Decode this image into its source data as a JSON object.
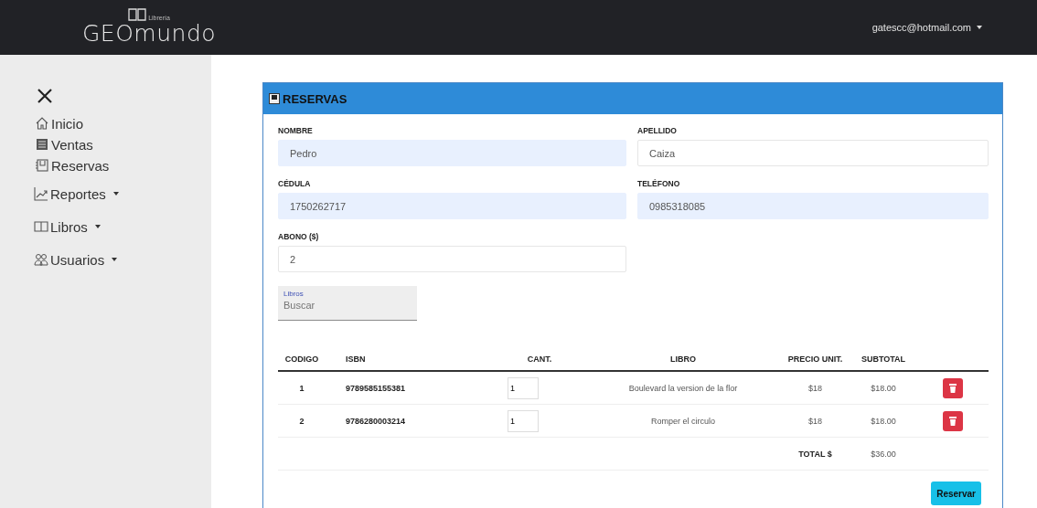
{
  "navbar": {
    "brand_small": "Librería",
    "brand_bold": "GEO",
    "brand_rest": "mundo",
    "user": "gatescc@hotmail.com"
  },
  "sidebar": {
    "items": [
      {
        "label": "Inicio",
        "kind": "link"
      },
      {
        "label": "Ventas",
        "kind": "link"
      },
      {
        "label": "Reservas",
        "kind": "link"
      },
      {
        "label": "Reportes",
        "kind": "dropdown"
      },
      {
        "label": "Libros",
        "kind": "dropdown"
      },
      {
        "label": "Usuarios",
        "kind": "dropdown"
      }
    ]
  },
  "card": {
    "title": "RESERVAS",
    "fields": [
      {
        "label": "NOMBRE",
        "value": "Pedro",
        "autofilled": true
      },
      {
        "label": "APELLIDO",
        "value": "Caiza",
        "autofilled": false
      },
      {
        "label": "CÉDULA",
        "value": "1750262717",
        "autofilled": true
      },
      {
        "label": "TELÉFONO",
        "value": "0985318085",
        "autofilled": true
      },
      {
        "label": "ABONO ($)",
        "value": "2",
        "autofilled": false
      }
    ],
    "search": {
      "label": "Libros",
      "placeholder": "Buscar"
    },
    "table": {
      "columns": [
        "CODIGO",
        "ISBN",
        "CANT.",
        "LIBRO",
        "PRECIO UNIT.",
        "SUBTOTAL"
      ],
      "rows": [
        {
          "codigo": "1",
          "isbn": "9789585155381",
          "cantidad": "1",
          "libro": "Boulevard la version de la flor",
          "precio": "$18",
          "subtotal": "$18.00"
        },
        {
          "codigo": "2",
          "isbn": "9786280003214",
          "cantidad": "1",
          "libro": "Romper el circulo",
          "precio": "$18",
          "subtotal": "$18.00"
        }
      ],
      "total_label": "TOTAL $",
      "total_value": "$36.00"
    },
    "button": "Reservar"
  }
}
